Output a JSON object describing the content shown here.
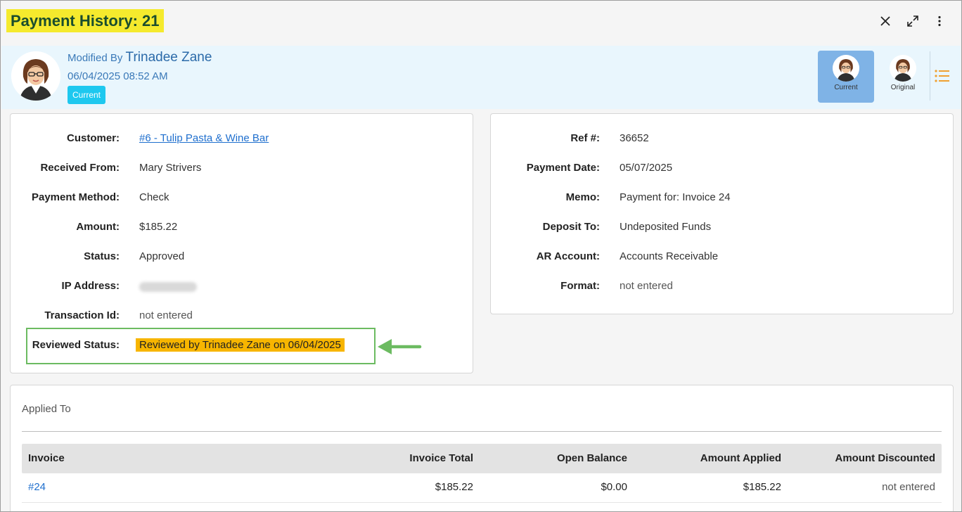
{
  "window": {
    "title": "Payment History: 21",
    "controls": [
      "close-icon",
      "expand-icon",
      "more-vert-icon"
    ]
  },
  "modified": {
    "prefix": "Modified By",
    "name": "Trinadee Zane",
    "datetime": "06/04/2025 08:52 AM",
    "badge": "Current"
  },
  "versions": [
    {
      "label": "Current",
      "active": true
    },
    {
      "label": "Original",
      "active": false
    }
  ],
  "left_card": {
    "fields": [
      {
        "label": "Customer:",
        "value": "#6 - Tulip Pasta & Wine Bar",
        "type": "link"
      },
      {
        "label": "Received From:",
        "value": "Mary Strivers"
      },
      {
        "label": "Payment Method:",
        "value": "Check"
      },
      {
        "label": "Amount:",
        "value": "$185.22"
      },
      {
        "label": "Status:",
        "value": "Approved"
      },
      {
        "label": "IP Address:",
        "value": "",
        "type": "blurred"
      },
      {
        "label": "Transaction Id:",
        "value": "not entered",
        "type": "muted"
      }
    ],
    "reviewed": {
      "label": "Reviewed Status:",
      "value": "Reviewed by Trinadee Zane on 06/04/2025"
    }
  },
  "right_card": {
    "fields": [
      {
        "label": "Ref #:",
        "value": "36652"
      },
      {
        "label": "Payment Date:",
        "value": "05/07/2025"
      },
      {
        "label": "Memo:",
        "value": "Payment for: Invoice 24"
      },
      {
        "label": "Deposit To:",
        "value": "Undeposited Funds"
      },
      {
        "label": "AR Account:",
        "value": "Accounts Receivable"
      },
      {
        "label": "Format:",
        "value": "not entered",
        "type": "muted"
      }
    ]
  },
  "applied_to": {
    "title": "Applied To",
    "columns": [
      "Invoice",
      "Invoice Total",
      "Open Balance",
      "Amount Applied",
      "Amount Discounted"
    ],
    "rows": [
      [
        "#24",
        "$185.22",
        "$0.00",
        "$185.22",
        "not entered"
      ]
    ]
  },
  "colors": {
    "title_highlight": "#f5ea2d",
    "title_text": "#1a4d2e",
    "band_bg": "#e9f6fd",
    "badge": "#1ec8ef",
    "active_version": "#7fb3e6",
    "reviewed_highlight": "#f7b500",
    "callout_green": "#6cbb61",
    "link": "#1f6fce"
  }
}
